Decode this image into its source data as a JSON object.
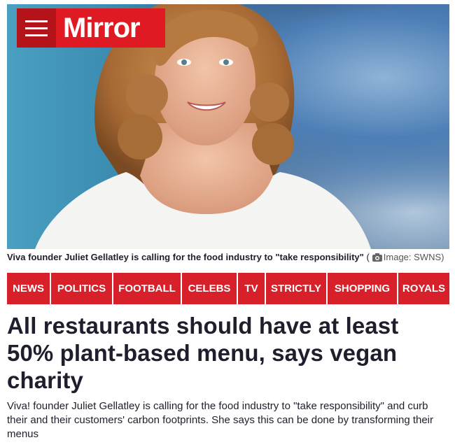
{
  "header": {
    "brand": "Mirror",
    "menu_icon": "hamburger-menu-icon",
    "brand_color": "#e01a22"
  },
  "photo": {
    "caption": "Viva founder Juliet Gellatley is calling for the food industry to \"take responsibility\"",
    "credit_open": "(",
    "credit": "Image: SWNS)",
    "camera_icon": "camera-icon"
  },
  "nav": {
    "color": "#d8202b",
    "items": [
      {
        "label": "NEWS"
      },
      {
        "label": "POLITICS"
      },
      {
        "label": "FOOTBALL"
      },
      {
        "label": "CELEBS"
      },
      {
        "label": "TV"
      },
      {
        "label": "STRICTLY"
      },
      {
        "label": "SHOPPING"
      },
      {
        "label": "ROYALS"
      }
    ]
  },
  "article": {
    "headline": "All restaurants should have at least 50% plant-based menu, says vegan charity",
    "standfirst": "Viva! founder Juliet Gellatley is calling for the food industry to \"take responsibility\" and curb their and their customers' carbon footprints. She says this can be done by transforming their menus"
  }
}
